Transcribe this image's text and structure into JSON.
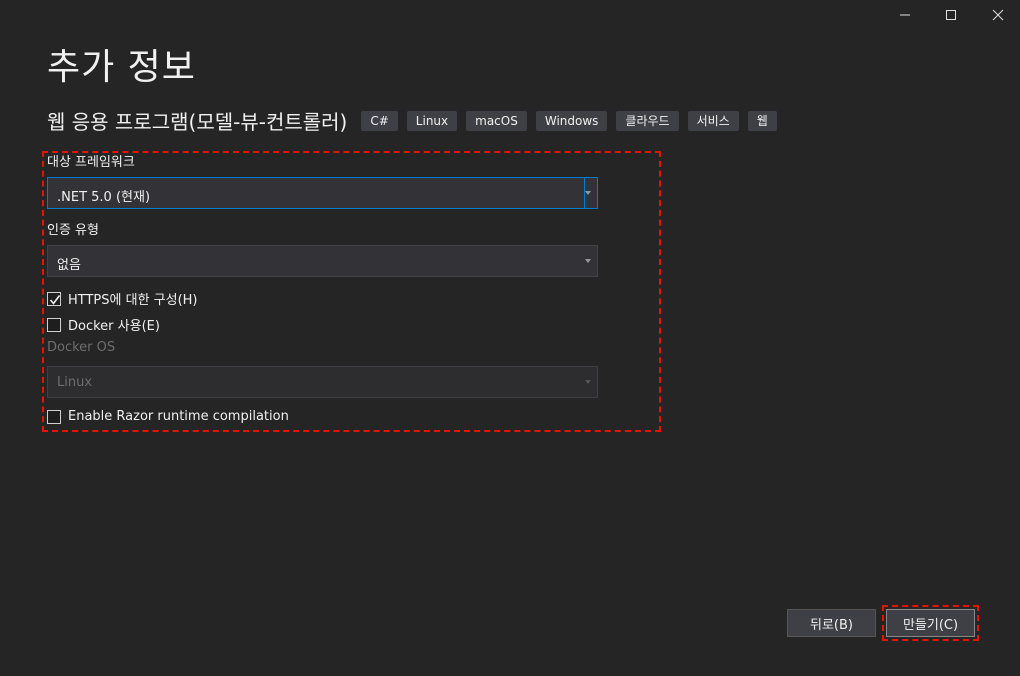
{
  "window": {
    "minimize_icon": "minimize-icon",
    "maximize_icon": "maximize-icon",
    "close_icon": "close-icon"
  },
  "header": {
    "title": "추가 정보",
    "subtitle": "웹 응용 프로그램(모델-뷰-컨트롤러)",
    "tags": [
      "C#",
      "Linux",
      "macOS",
      "Windows",
      "클라우드",
      "서비스",
      "웹"
    ]
  },
  "form": {
    "framework_label": "대상 프레임워크",
    "framework_value": ".NET 5.0 (현재)",
    "auth_label": "인증 유형",
    "auth_value": "없음",
    "https_label": "HTTPS에 대한 구성(H)",
    "https_checked": true,
    "docker_label": "Docker 사용(E)",
    "docker_checked": false,
    "docker_os_label": "Docker OS",
    "docker_os_value": "Linux",
    "razor_label": "Enable Razor runtime compilation",
    "razor_checked": false
  },
  "footer": {
    "back_label": "뒤로(B)",
    "create_label": "만들기(C)"
  },
  "colors": {
    "background": "#252526",
    "highlight_outline": "#e51400",
    "focus_border": "#007acc"
  }
}
